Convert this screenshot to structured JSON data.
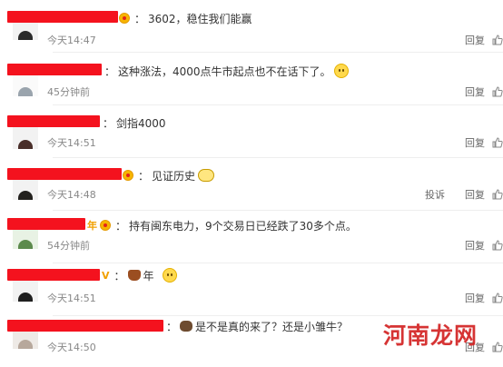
{
  "comments": [
    {
      "text": "3602，稳住我们能赢",
      "time": "今天14:47",
      "actions": [
        "回复"
      ],
      "emoji": ""
    },
    {
      "text": "这种涨法，4000点牛市起点也不在话下了。",
      "time": "45分钟前",
      "actions": [
        "回复"
      ],
      "emoji": "smirk-emoji"
    },
    {
      "text": "剑指4000",
      "time": "今天14:51",
      "actions": [
        "回复"
      ],
      "emoji": ""
    },
    {
      "text": "见证历史",
      "time": "今天14:48",
      "actions": [
        "投诉",
        "回复"
      ],
      "emoji": "glasses-emoji"
    },
    {
      "text": "持有闽东电力，9个交易日已经跌了30多个点。",
      "time": "54分钟前",
      "actions": [
        "回复"
      ],
      "emoji": ""
    },
    {
      "text": "年",
      "time": "今天14:51",
      "actions": [
        "回复"
      ],
      "emoji": "ox-emoji"
    },
    {
      "text": "是不是真的来了？还是小雏牛？",
      "time": "今天14:50",
      "actions": [
        "回复"
      ],
      "emoji": "bear-emoji"
    }
  ],
  "watermark": "河南龙网",
  "colors": {
    "redaction": "#f4121e",
    "meta": "#888888",
    "accent": "#f7b500"
  }
}
